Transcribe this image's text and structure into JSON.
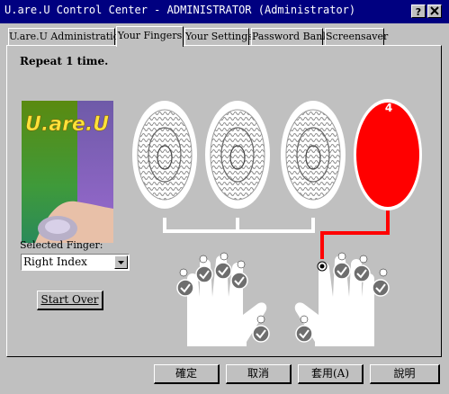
{
  "window": {
    "title": "U.are.U Control Center - ADMINISTRATOR (Administrator)",
    "help_button": "?",
    "close_button": "X"
  },
  "tabs": [
    {
      "label": "U.are.U Administration",
      "active": false
    },
    {
      "label": "Your Fingers",
      "active": true
    },
    {
      "label": "Your Settings",
      "active": false
    },
    {
      "label": "Password Bank",
      "active": false
    },
    {
      "label": "Screensaver",
      "active": false
    }
  ],
  "instruction": "Repeat 1 time.",
  "logo": {
    "text": "U.are.U"
  },
  "selected_finger": {
    "label": "Selected Finger:",
    "value": "Right Index"
  },
  "start_over_button": "Start Over",
  "scans": {
    "current_step_number": "4",
    "completed_count": 3,
    "highlight_color": "#ff0000"
  },
  "fingers": {
    "check_color": "#6e6e6e",
    "left_hand_enrolled": 5,
    "right_hand_enrolled": 4,
    "right_hand_selected": "index"
  },
  "footer_buttons": {
    "ok": "確定",
    "cancel": "取消",
    "apply": "套用(A)",
    "help": "說明"
  }
}
